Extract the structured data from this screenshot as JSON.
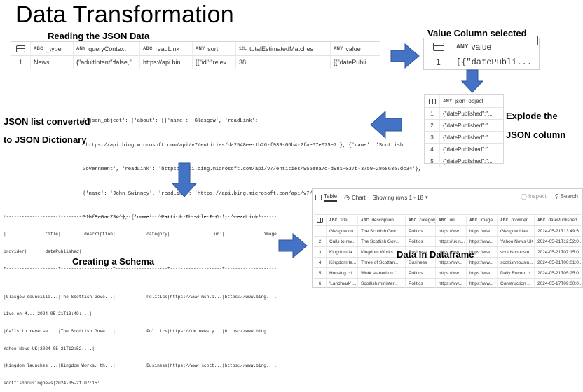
{
  "title": "Data Transformation",
  "labels": {
    "reading": "Reading the JSON Data",
    "value_selected": "Value Column selected",
    "explode_line1": "Explode the",
    "explode_line2": "JSON column",
    "converted_line1": "JSON list converted",
    "converted_line2": "to JSON Dictionary",
    "schema": "Creating a Schema",
    "dataframe": "Data in Dataframe"
  },
  "reading_table": {
    "headers": [
      {
        "type": "ABC",
        "name": "_type"
      },
      {
        "type": "ANY",
        "name": "queryContext"
      },
      {
        "type": "ABC",
        "name": "readLink"
      },
      {
        "type": "ANY",
        "name": "sort"
      },
      {
        "type": "12L",
        "name": "totalEstimatedMatches"
      },
      {
        "type": "ANY",
        "name": "value"
      }
    ],
    "row": [
      "1",
      "News",
      "{\"adultIntent\":false,\"...",
      "https://api.bin...",
      "[{\"id\":\"relev...",
      "38",
      "[{\"datePubli..."
    ]
  },
  "value_table": {
    "header": {
      "type": "ANY",
      "name": "value"
    },
    "row": [
      "1",
      "[{\"datePubli..."
    ]
  },
  "json_object_table": {
    "header": {
      "type": "ANY",
      "name": "json_object"
    },
    "rows": [
      [
        "1",
        "{\"datePublished\":\"..."
      ],
      [
        "2",
        "{\"datePublished\":\"..."
      ],
      [
        "3",
        "{\"datePublished\":\"..."
      ],
      [
        "4",
        "{\"datePublished\":\"..."
      ],
      [
        "5",
        "{\"datePublished\":\"..."
      ]
    ]
  },
  "json_dict_text": [
    "{'json_object': {'about': [{'name': 'Glasgow', 'readLink':",
    "'https://api.bing.microsoft.com/api/v7/entities/da2548ee-1b26-f939-06b4-2fae57e075e7'}, {'name': 'Scottish",
    "Government', 'readLink': 'https://api.bing.microsoft.com/api/v7/entities/955e8a7c-d981-037b-3759-28686357dc34'},",
    "{'name': 'John Swinney', 'readLink': 'https://api.bing.microsoft.com/api/v7/entities/a17a009-da2b-77f4-73eb-",
    "31bf9a8ac734'}, {'name': 'Partick Thistle F.C.', 'readLink':"
  ],
  "schema_text": [
    "+--------------------+--------------------+--------------------+--------------------+--------------------+",
    "|               title|         description|            category|                 url|               image|",
    "provider|       datePublished|",
    "+--------------------+--------------------+--------------------+--------------------+--------------------+",
    "|Glasgow councillo...|The Scottish Gove...|            Politics|https://www.msn.c...|https://www.bing....|Glasgow",
    "Live on M...|2024-05-21T13:49:...|",
    "|Calls to reverse ...|The Scottish Gove...|            Politics|https://uk.news.y...|https://www.bing....|",
    "Yahoo News UK|2024-05-21T12:52:...|",
    "|Kingdom launches ...|Kingdom Works, th...|            Business|https://www.scott...|https://www.bing....|",
    "scottishhousingnews|2024-05-21T07:15:...|"
  ],
  "dataframe": {
    "tabs": [
      "Table",
      "Chart"
    ],
    "showing": "Showing rows 1 - 18",
    "inspect": "Inspect",
    "search": "Search",
    "headers": [
      {
        "type": "ABC",
        "name": "title"
      },
      {
        "type": "ABC",
        "name": "description"
      },
      {
        "type": "ABC",
        "name": "category"
      },
      {
        "type": "ABC",
        "name": "url"
      },
      {
        "type": "ABC",
        "name": "image"
      },
      {
        "type": "ABC",
        "name": "provider"
      },
      {
        "type": "ABC",
        "name": "datePublished"
      }
    ],
    "rows": [
      [
        "1",
        "Glasgow co...",
        "The Scottish Gov...",
        "Politics",
        "https://ww...",
        "https://ww...",
        "Glasgow Live ...",
        "2024-05-21T13:49:5..."
      ],
      [
        "2",
        "Calls to rev...",
        "The Scottish Gov...",
        "Politics",
        "https://uk.n...",
        "https://ww...",
        "Yahoo News UK",
        "2024-05-21T12:52:0..."
      ],
      [
        "3",
        "Kingdom la...",
        "Kingdom Works...",
        "Business",
        "https://ww...",
        "https://ww...",
        "scottishhousin...",
        "2024-05-21T07:15:0..."
      ],
      [
        "4",
        "Kingdom ta...",
        "Three of Scottan...",
        "Business",
        "https://ww...",
        "https://ww...",
        "scottishhousin...",
        "2024-05-21T00:01:0..."
      ],
      [
        "5",
        "Housing cri...",
        "Work started on f...",
        "Politics",
        "https://ww...",
        "https://ww...",
        "Daily Record o...",
        "2024-05-21T05:25:0..."
      ],
      [
        "6",
        "'Landmark' ...",
        "Scottish minister...",
        "Politics",
        "https://ww...",
        "https://ww...",
        "Construction ...",
        "2024-05-17T09:00:0..."
      ]
    ]
  },
  "colors": {
    "arrow": "#4472c4",
    "arrow_edge": "#2f5597",
    "header_bg": "#f7f7f7"
  },
  "icons": [
    "grid-icon",
    "table-icon",
    "chart-icon",
    "inspect-icon",
    "search-icon",
    "scroll-handle-icon"
  ]
}
